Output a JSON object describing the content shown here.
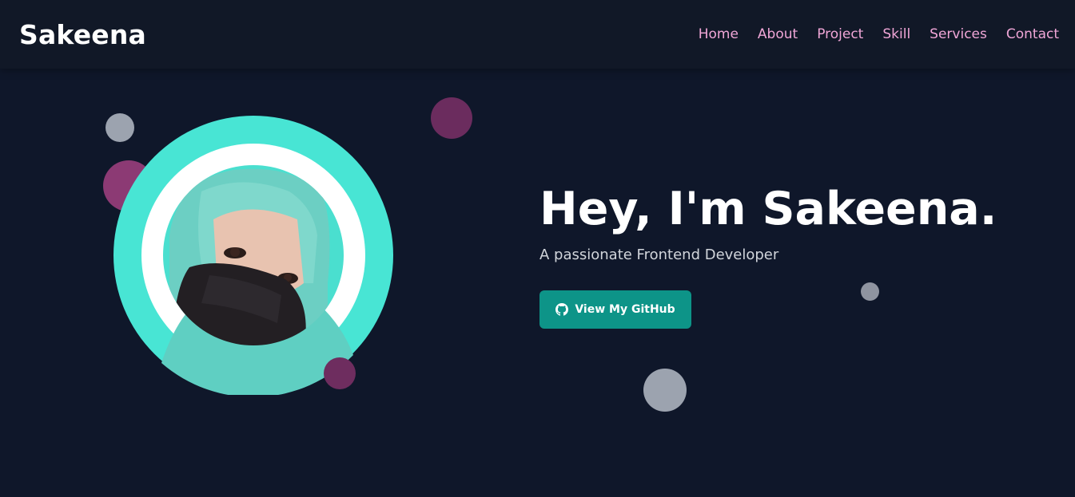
{
  "navbar": {
    "brand": "Sakeena",
    "links": [
      {
        "label": "Home"
      },
      {
        "label": "About"
      },
      {
        "label": "Project"
      },
      {
        "label": "Skill"
      },
      {
        "label": "Services"
      },
      {
        "label": "Contact"
      }
    ]
  },
  "hero": {
    "title": "Hey, I'm Sakeena.",
    "subtitle": "A passionate Frontend Developer",
    "button_label": "View My GitHub",
    "button_icon": "github-icon",
    "avatar_icon": "profile-photo"
  },
  "colors": {
    "background": "#0f172a",
    "navbar": "#111827",
    "nav_link": "#f0a6d7",
    "accent_teal": "#48e5d4",
    "button": "#0d9488",
    "bubble_pink": "#8c3a74",
    "bubble_gray": "#9ca3af"
  }
}
